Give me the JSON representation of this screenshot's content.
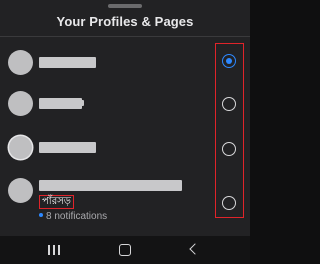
{
  "sheet": {
    "title": "Your Profiles & Pages"
  },
  "profiles": [
    {
      "selected": true
    },
    {
      "selected": false
    },
    {
      "selected": false
    },
    {
      "selected": false,
      "page_name": "পাঁরসড়",
      "notifications": "8 notifications"
    }
  ],
  "colors": {
    "accent": "#2d88ff",
    "highlight": "#e0242a",
    "background": "#222224"
  },
  "nav": {
    "recents_icon": "recents-icon",
    "home_icon": "home-icon",
    "back_icon": "back-icon"
  }
}
